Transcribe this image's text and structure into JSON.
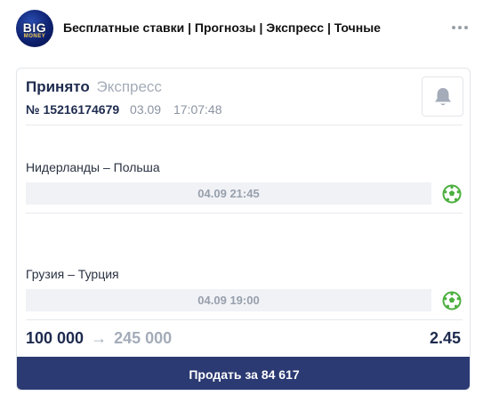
{
  "post": {
    "channel_title": "Бесплатные ставки | Прогнозы | Экспресс | Точные",
    "avatar": {
      "line1": "BIG",
      "line2": "MONEY"
    },
    "more_icon": "more-dots-icon"
  },
  "bet": {
    "status": "Принято",
    "type": "Экспресс",
    "number": "№ 15216174679",
    "date": "03.09",
    "time": "17:07:48",
    "bell_icon": "bell-icon",
    "matches": [
      {
        "name": "Нидерланды – Польша",
        "datetime": "04.09 21:45",
        "sport_icon": "football-icon"
      },
      {
        "name": "Грузия – Турция",
        "datetime": "04.09 19:00",
        "sport_icon": "football-icon"
      }
    ],
    "stake": "100 000",
    "arrow": "→",
    "payout": "245 000",
    "coefficient": "2.45",
    "sell_label": "Продать за 84 617"
  },
  "colors": {
    "accent": "#2b3a72",
    "title_text": "#1e2b4f",
    "muted_text": "#a4acb9",
    "ball_green": "#4caf3e"
  }
}
